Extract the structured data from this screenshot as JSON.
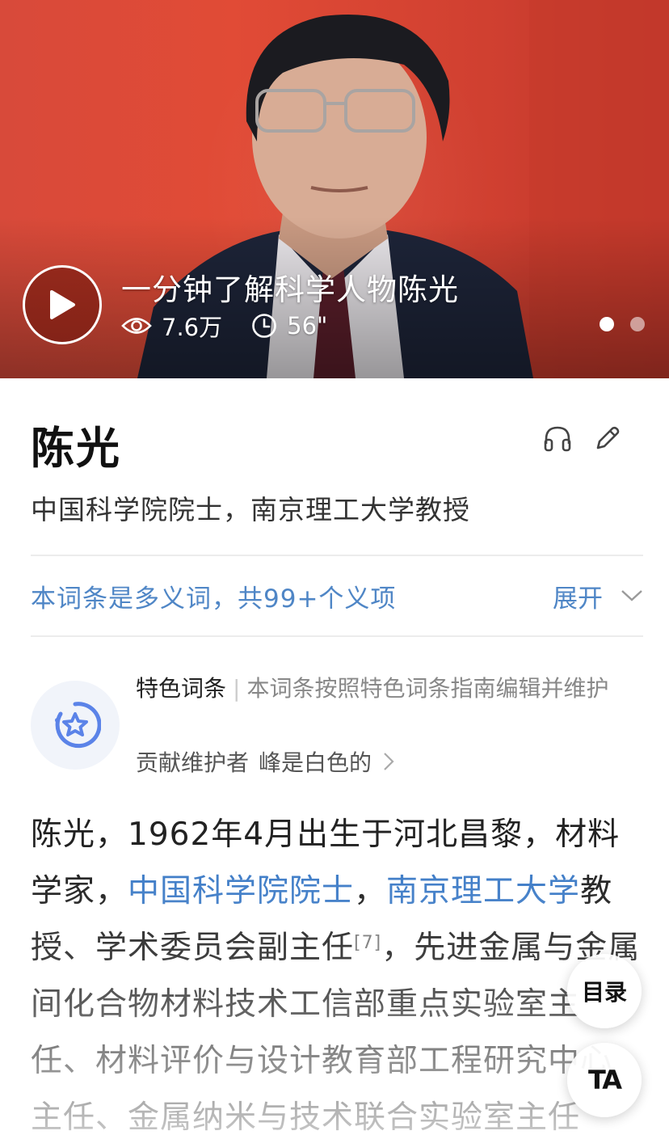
{
  "hero": {
    "video_title": "一分钟了解科学人物陈光",
    "views": "7.6万",
    "duration": "56\"",
    "icons": [
      "play-icon",
      "eye-icon",
      "clock-icon"
    ],
    "page_count": 2,
    "active_page": 1
  },
  "entry": {
    "title": "陈光",
    "subtitle": "中国科学院院士，南京理工大学教授",
    "icons": [
      "headphones-icon",
      "pencil-icon"
    ]
  },
  "polysemy": {
    "text": "本词条是多义词，共99+个义项",
    "expand_label": "展开"
  },
  "featured": {
    "label": "特色词条",
    "description": "本词条按照特色词条指南编辑并维护",
    "contributor_prefix": "贡献维护者",
    "contributor_name": "峰是白色的"
  },
  "body": {
    "p1_a": "陈光，1962年4月出生于河北昌黎，材料学家，",
    "link1": "中国科学院院士",
    "p1_b": "，",
    "link2": "南京理工大学",
    "p1_c": "教授、学术委员会副主任",
    "ref": "[7]",
    "p1_d": "，先进金属与金属间化合物材料技术工信部重点实验室主任、材料评价与设计教育部工程研究中心主任、金属纳米与技术联合实验室主任"
  },
  "floating": {
    "toc_label": "目录",
    "ta_label": "TA"
  },
  "colors": {
    "link": "#3e7cc7",
    "poly_link": "#4f86c6",
    "hero_bg": "#e14b36"
  }
}
